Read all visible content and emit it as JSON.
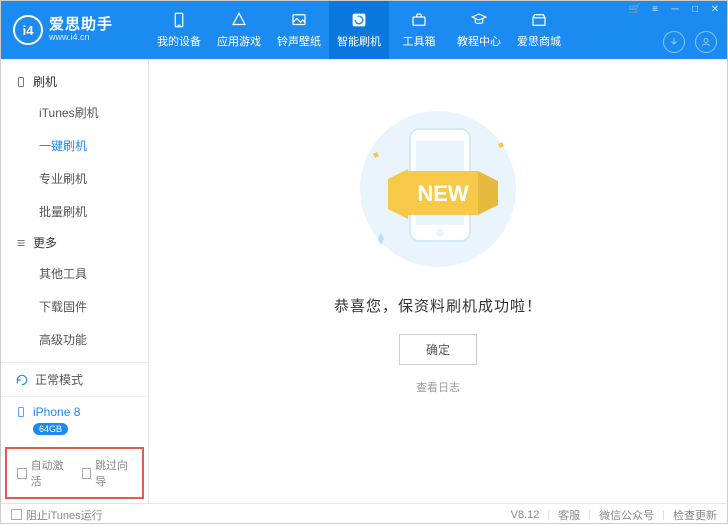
{
  "brand": {
    "name": "爱思助手",
    "url": "www.i4.cn",
    "logo_text": "i4"
  },
  "nav": {
    "items": [
      {
        "label": "我的设备"
      },
      {
        "label": "应用游戏"
      },
      {
        "label": "铃声壁纸"
      },
      {
        "label": "智能刷机",
        "active": true
      },
      {
        "label": "工具箱"
      },
      {
        "label": "教程中心"
      },
      {
        "label": "爱思商城"
      }
    ]
  },
  "sidebar": {
    "group1": {
      "title": "刷机",
      "items": [
        "iTunes刷机",
        "一键刷机",
        "专业刷机",
        "批量刷机"
      ],
      "active_index": 1
    },
    "group2": {
      "title": "更多",
      "items": [
        "其他工具",
        "下载固件",
        "高级功能"
      ]
    },
    "mode_label": "正常模式",
    "device": {
      "name": "iPhone 8",
      "capacity": "64GB"
    },
    "checkboxes": {
      "auto_activate": "自动激活",
      "skip_guide": "跳过向导"
    }
  },
  "main": {
    "success_message": "恭喜您，保资料刷机成功啦！",
    "ok_button": "确定",
    "view_log": "查看日志",
    "new_badge": "NEW"
  },
  "footer": {
    "block_itunes": "阻止iTunes运行",
    "version": "V8.12",
    "support": "客服",
    "wechat": "微信公众号",
    "check_update": "检查更新"
  }
}
